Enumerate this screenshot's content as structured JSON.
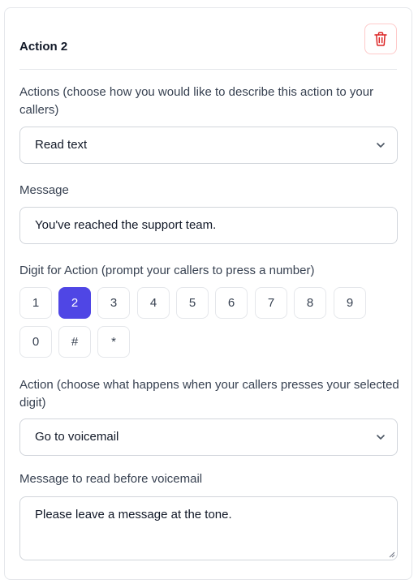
{
  "card": {
    "title": "Action 2",
    "delete_icon": "trash-icon"
  },
  "actions_field": {
    "label": "Actions (choose how you would like to describe this action to your callers)",
    "selected": "Read text"
  },
  "message_field": {
    "label": "Message",
    "value": "You've reached the support team."
  },
  "digit_field": {
    "label": "Digit for Action (prompt your callers to press a number)",
    "digits": [
      "1",
      "2",
      "3",
      "4",
      "5",
      "6",
      "7",
      "8",
      "9",
      "0",
      "#",
      "*"
    ],
    "selected": "2"
  },
  "action_field": {
    "label": "Action (choose what happens when your callers presses your selected digit)",
    "selected": "Go to voicemail"
  },
  "voicemail_message_field": {
    "label": "Message to read before voicemail",
    "value": "Please leave a message at the tone."
  },
  "colors": {
    "accent": "#4f46e5",
    "danger": "#dc2626",
    "border": "#d1d5db"
  }
}
